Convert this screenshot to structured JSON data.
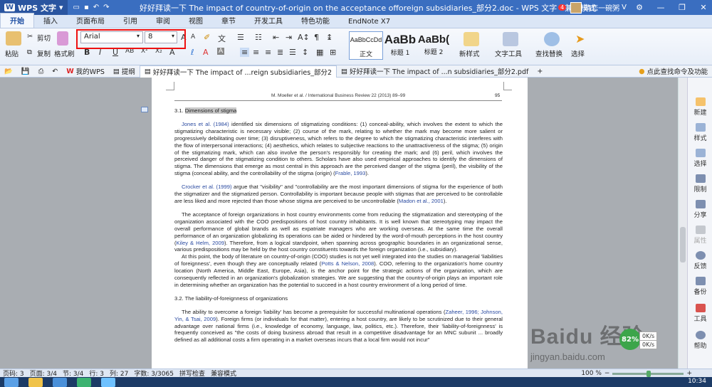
{
  "titlebar": {
    "app_name": "WPS 文字",
    "document_title": "好好拜读一下 The impact of country-of-origin on the acceptance offoreign subsidiaries_部分2.doc - WPS 文字 - 兼容模式",
    "notification_count": "4",
    "username": "晴恋一碗粥"
  },
  "menu": {
    "tabs": [
      "开始",
      "插入",
      "页面布局",
      "引用",
      "审阅",
      "视图",
      "章节",
      "开发工具",
      "特色功能",
      "EndNote X7"
    ],
    "active_tab": "开始"
  },
  "ribbon": {
    "paste_label": "粘贴",
    "cut_label": "剪切",
    "copy_label": "复制",
    "format_painter_label": "格式刷",
    "font_name": "Arial",
    "font_size": "8",
    "styles": [
      {
        "sample": "AaBbCcDd",
        "label": "正文"
      },
      {
        "sample": "AaBb",
        "label": "标题 1"
      },
      {
        "sample": "AaBb(",
        "label": "标题 2"
      }
    ],
    "new_style_label": "新样式",
    "text_tools_label": "文字工具",
    "find_replace_label": "查找替换",
    "select_label": "选择"
  },
  "doc_tabs": {
    "tabs": [
      {
        "label": "我的WPS",
        "active": false
      },
      {
        "label": "提纲",
        "active": false
      },
      {
        "label": "好好拜读一下 The impact of ...reign subsidiaries_部分2",
        "active": true
      },
      {
        "label": "好好拜读一下 The impact of ...n subsidiaries_部分2.pdf",
        "active": false
      }
    ],
    "hint": "点此查找命令及功能"
  },
  "document": {
    "running_header": "M. Moeller et al. / International Business Review 22 (2013) 89–99",
    "page_number": "95",
    "section1_number": "3.1.",
    "section1_title": "Dimensions of stigma",
    "p1_ref": "Jones et al. (1984)",
    "p1_text": " identified six dimensions of stigmatizing conditions: (1) conceal-ability, which involves the extent to which the stigmatizing characteristic is necessary visible; (2) course of the mark, relating to whether the mark may become more salient or progressively debilitating over time; (3) disruptiveness, which refers to the degree to which the stigmatizing characteristic interferes with the flow of interpersonal interactions; (4) aesthetics, which relates to subjective reactions to the unattractiveness of the stigma; (5) origin of the stigmatizing mark, which can also involve the person's responsibly for creating the mark; and (6) peril, which involves the perceived danger of the stigmatizing condition to others. Scholars have also used empirical approaches to identify the dimensions of stigma. The dimensions that emerge as most central in this approach are the perceived danger of the stigma (peril), the visibility of the stigma (conceal ability, and the controllability of the stigma (origin) (",
    "p1_ref2": "Frable, 1993",
    "p1_end": ").",
    "p2_ref": "Crocker et al. (1999)",
    "p2_text": " argue that \"visibility\" and \"controllability are the most important dimensions of stigma for the experience of both the stigmatizer and the stigmatized person. Controllability is important because people with stigmas that are perceived to be controllable are less liked and more rejected than those whose stigma are perceived to be uncontrollable (",
    "p2_ref2": "Madon et al., 2001",
    "p2_end": ").",
    "p3_text": "The acceptance of foreign organizations in host country environments come from reducing the stigmatization and stereotyping of the organization associated with the COO predispositions of host country inhabitants. It is well known that stereotyping may impact the overall performance of global brands as well as expatriate managers who are working overseas. At the same time the overall performance of an organization globalizing its operations can be aided or hindered by the word-of-mouth perceptions in the host country (",
    "p3_ref": "Kiley & Helm, 2009",
    "p3_end": "). Therefore, from a logical standpoint, when spanning across geographic boundaries in an organizational sense, various predispositions may be held by the host country constituents towards the foreign organization (i.e., subsidiary).",
    "p4_text": "At this point, the body of literature on country-of-origin (COO) studies is not yet well integrated into the studies on managerial 'liabilities of foreignness', even though they are conceptually related (",
    "p4_ref": "Potts & Nelson, 2008",
    "p4_end": "). COO, referring to the organization's home country location (North America, Middle East, Europe, Asia), is the anchor point for the strategic actions of the organization, which are consequently reflected in an organization's globalization strategies. We are suggesting that the country-of-origin plays an important role in determining whether an organization has the potential to succeed in a host country environment of a long period of time.",
    "section2_number": "3.2.",
    "section2_title": "The liability-of-foreignness of organizations",
    "p5_text": "The ability to overcome a foreign 'liability' has become a prerequisite for successful multinational operations (",
    "p5_ref": "Zaheer, 1996; Johnson, Yin, & Tsai, 2009",
    "p5_end": "). Foreign firms (or individuals for that matter), entering a host country, are likely to be scrutinized due to their general advantage over national firms (i.e., knowledge of economy, language, law, politics, etc.). Therefore, their 'liability-of-foreignness' is frequently conceived as \"the costs of doing business abroad that result in a competitive disadvantage for an MNC subunit ... broadly defined as all additional costs a firm operating in a market overseas incurs that a local firm would not incur\""
  },
  "sidebar": {
    "items": [
      "新建",
      "样式",
      "选择",
      "限制",
      "分享",
      "属性",
      "反馈",
      "备份",
      "工具",
      "帮助"
    ]
  },
  "watermark": {
    "logo": "Baidu 经验",
    "url": "jingyan.baidu.com"
  },
  "widget": {
    "percent": "82%",
    "speed_up": "0K/s",
    "speed_down": "0K/s"
  },
  "statusbar": {
    "page": "页码: 3",
    "pages": "页面: 3/4",
    "section": "节: 3/4",
    "row": "行: 3",
    "col": "列: 27",
    "words": "字数: 3/3065",
    "spellcheck": "拼写检查",
    "mode": "兼容模式",
    "zoom": "100 %"
  },
  "taskbar": {
    "clock": "10:34"
  },
  "colors": {
    "titlebar": "#3a6ec0",
    "highlight_box": "#e11111",
    "reference_link": "#2a4aa0"
  }
}
